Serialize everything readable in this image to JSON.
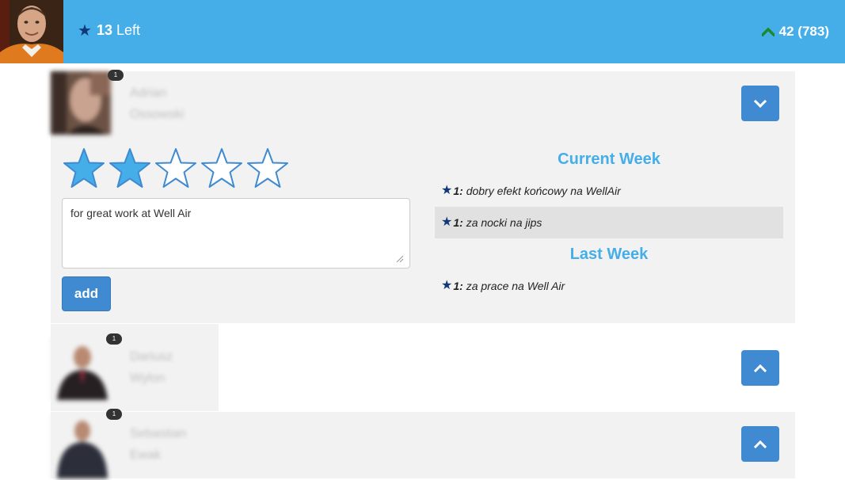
{
  "header": {
    "points_left_value": "13",
    "points_left_label": "Left",
    "score_text": "42 (783)",
    "colors": {
      "bar": "#45aee8",
      "star": "#10397a",
      "up_arrow": "#1a8a2e"
    }
  },
  "people": [
    {
      "first_name": "Adrian",
      "last_name": "Ossowski",
      "badge": "1",
      "expanded": true,
      "rating": {
        "selected": 2,
        "max": 5
      },
      "comment": "for great work at Well Air",
      "add_label": "add",
      "current_week": {
        "title": "Current Week",
        "entries": [
          {
            "count": "1:",
            "text": "dobry efekt końcowy na WellAir"
          },
          {
            "count": "1:",
            "text": "za nocki na jips"
          }
        ]
      },
      "last_week": {
        "title": "Last Week",
        "entries": [
          {
            "count": "1:",
            "text": "za prace na Well Air"
          }
        ]
      }
    },
    {
      "first_name": "Dariusz",
      "last_name": "Wylon",
      "badge": "1",
      "expanded": false
    },
    {
      "first_name": "Sebastian",
      "last_name": "Ewak",
      "badge": "1",
      "expanded": false
    }
  ]
}
